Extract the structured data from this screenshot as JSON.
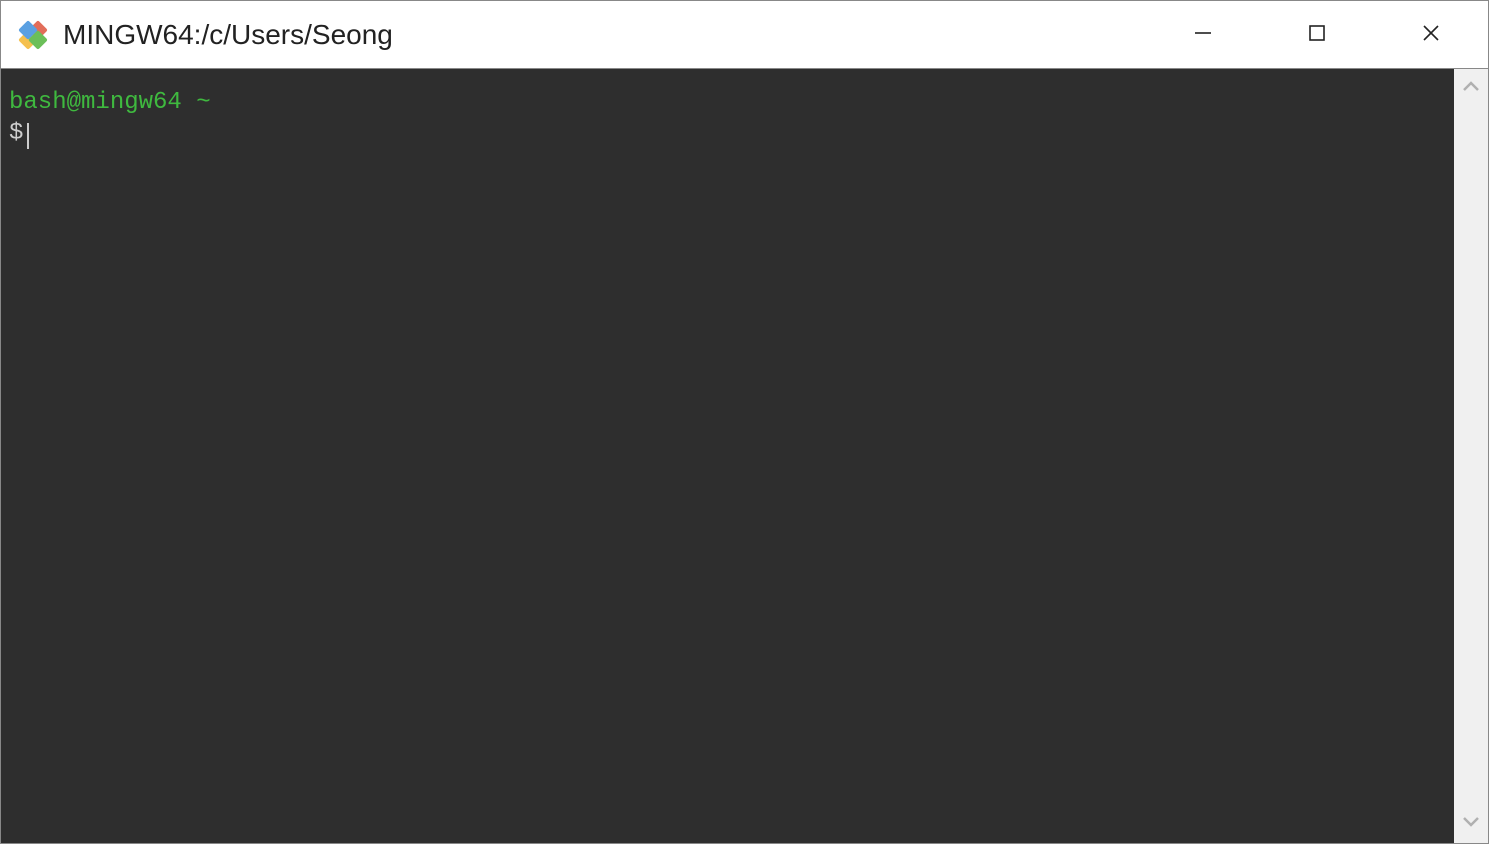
{
  "titlebar": {
    "title": "MINGW64:/c/Users/Seong"
  },
  "terminal": {
    "prompt_user_host": "bash@mingw64",
    "prompt_path": "~",
    "dollar": "$"
  },
  "colors": {
    "terminal_bg": "#2e2e2e",
    "prompt_green": "#3fb93f",
    "text": "#cccccc"
  }
}
